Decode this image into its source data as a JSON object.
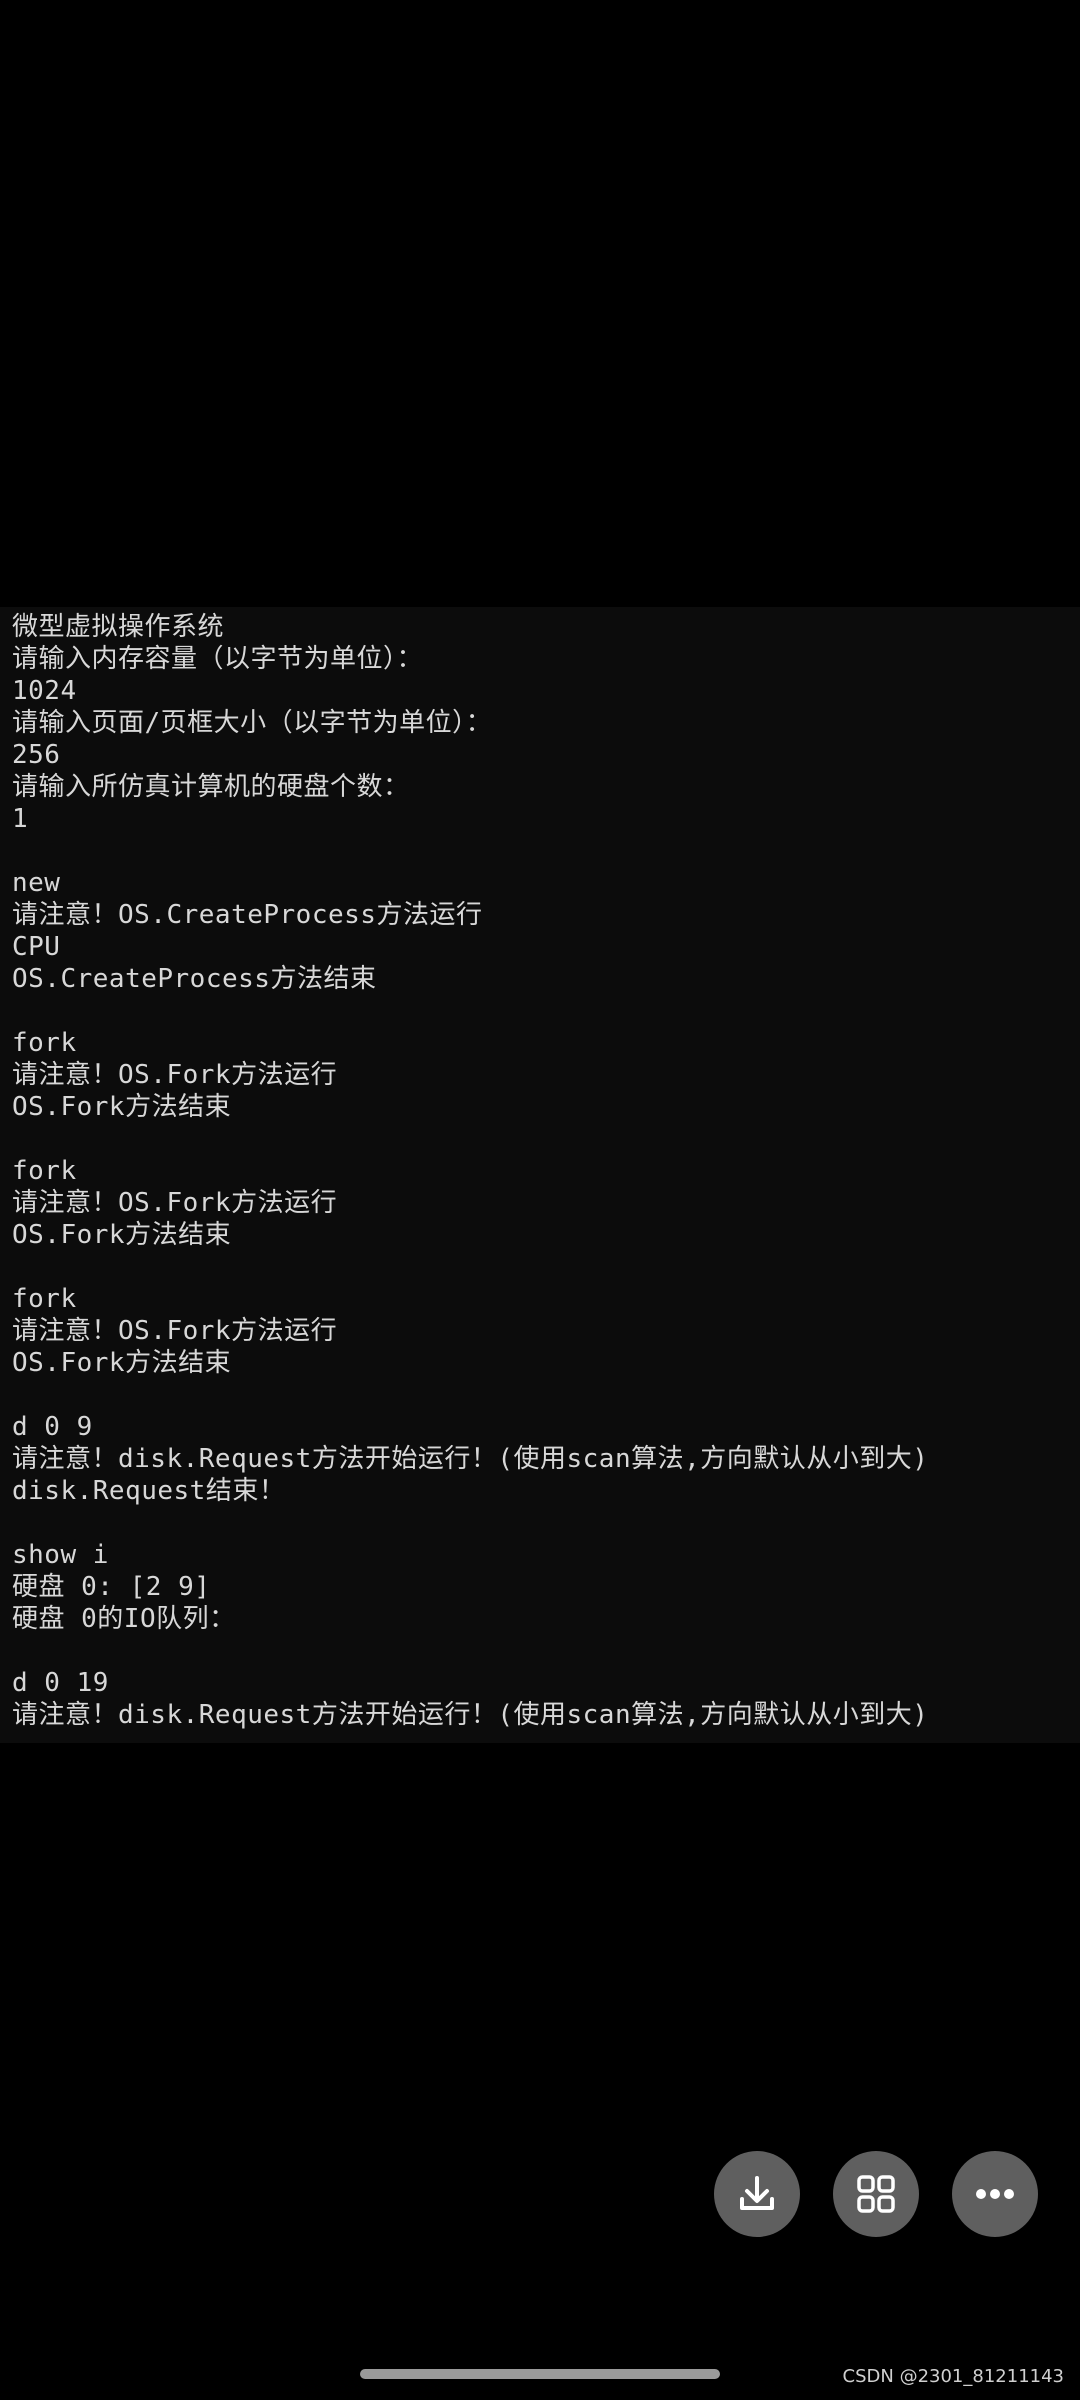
{
  "terminal": {
    "lines": [
      "微型虚拟操作系统",
      "请输入内存容量（以字节为单位）：",
      "1024",
      "请输入页面/页框大小（以字节为单位）：",
      "256",
      "请输入所仿真计算机的硬盘个数：",
      "1",
      "",
      "new",
      "请注意！OS.CreateProcess方法运行",
      "CPU",
      "OS.CreateProcess方法结束",
      "",
      "fork",
      "请注意！OS.Fork方法运行",
      "OS.Fork方法结束",
      "",
      "fork",
      "请注意！OS.Fork方法运行",
      "OS.Fork方法结束",
      "",
      "fork",
      "请注意！OS.Fork方法运行",
      "OS.Fork方法结束",
      "",
      "d 0 9",
      "请注意！disk.Request方法开始运行！(使用scan算法,方向默认从小到大)",
      "disk.Request结束！",
      "",
      "show i",
      "硬盘 0: [2 9]",
      "硬盘 0的IO队列：",
      "",
      "d 0 19",
      "请注意！disk.Request方法开始运行！(使用scan算法,方向默认从小到大)"
    ]
  },
  "actions": {
    "download_icon": "download-icon",
    "grid_icon": "grid-icon",
    "more_icon": "more-icon"
  },
  "watermark": "CSDN @2301_81211143"
}
